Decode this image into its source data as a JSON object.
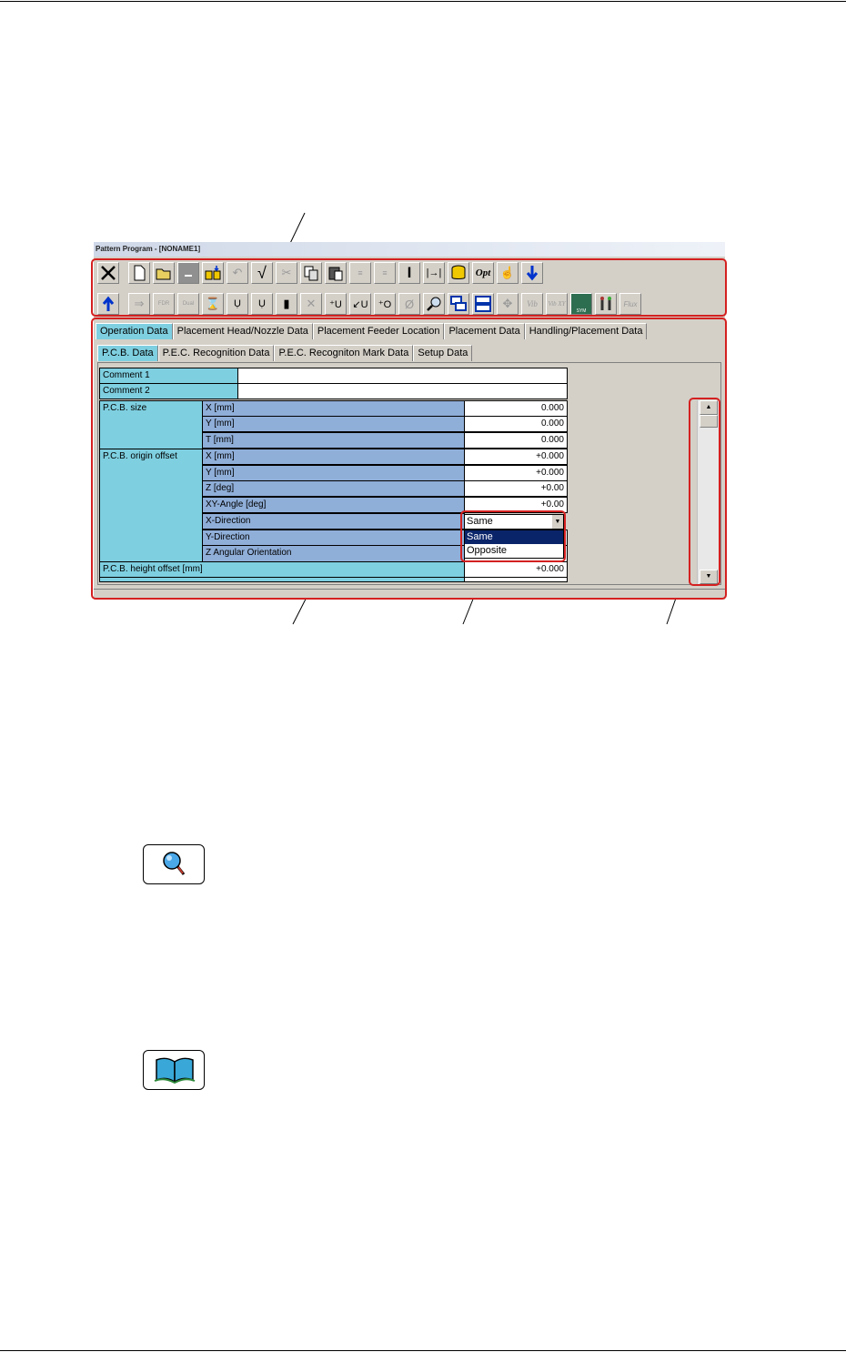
{
  "window": {
    "title": "Pattern Program - [NONAME1]"
  },
  "toolbar1": {
    "icons": [
      "close-icon",
      "new-file-icon",
      "open-folder-icon",
      "save-icon",
      "save-as-icon",
      "undo-icon",
      "check-icon",
      "cut-icon",
      "copy-icon",
      "paste-icon",
      "insert-row-icon",
      "add-row-icon",
      "cursor-icon",
      "goto-end-icon",
      "database-icon",
      "opt-icon",
      "hand-icon",
      "download-arrow-icon"
    ],
    "opt_label": "Opt"
  },
  "toolbar2": {
    "icons": [
      "up-arrow-icon",
      "transfer-icon",
      "fdr-icon",
      "dual-icon",
      "spool-icon",
      "nozzle-uv-icon",
      "nozzle-u-icon",
      "cylinder-icon",
      "cross-icon",
      "insert-u-icon",
      "place-u-icon",
      "add-o-icon",
      "no-o-icon",
      "magnifier-icon",
      "window-cascade-icon",
      "window-split-icon",
      "move-arrows-icon",
      "vib-icon",
      "vib-xy-icon",
      "sym-icon",
      "tools-icon",
      "flux-icon"
    ],
    "fdr_label": "FDR",
    "dual_label": "Dual",
    "vib_label": "Vib",
    "vibxy_label": "Vib XY",
    "sym_label": "SYM",
    "flux_label": "Flux"
  },
  "tabs_main": [
    "Operation Data",
    "Placement Head/Nozzle Data",
    "Placement Feeder Location",
    "Placement Data",
    "Handling/Placement Data"
  ],
  "tabs_sub": [
    "P.C.B. Data",
    "P.E.C. Recognition Data",
    "P.E.C. Recogniton Mark Data",
    "Setup Data"
  ],
  "grid": {
    "comment1_label": "Comment 1",
    "comment2_label": "Comment 2",
    "pcb_size_label": "P.C.B. size",
    "pcb_size_rows": [
      {
        "label": "X [mm]",
        "value": "0.000"
      },
      {
        "label": "Y [mm]",
        "value": "0.000"
      },
      {
        "label": "T [mm]",
        "value": "0.000"
      }
    ],
    "origin_offset_label": "P.C.B. origin offset",
    "origin_rows": [
      {
        "label": "X [mm]",
        "value": "+0.000"
      },
      {
        "label": "Y [mm]",
        "value": "+0.000"
      },
      {
        "label": "Z [deg]",
        "value": "+0.00"
      },
      {
        "label": "XY-Angle [deg]",
        "value": "+0.00"
      },
      {
        "label": "X-Direction",
        "value": ""
      },
      {
        "label": "Y-Direction",
        "value": ""
      },
      {
        "label": "Z Angular Orientation",
        "value": ""
      }
    ],
    "height_offset_label": "P.C.B. height offset [mm]",
    "height_offset_value": "+0.000"
  },
  "dropdown": {
    "selected": "Same",
    "options": [
      "Same",
      "Opposite"
    ],
    "highlighted": "Same"
  },
  "colors": {
    "annotation": "#d42020",
    "label_cell": "#7ecfe0",
    "sub_cell": "#8faed8",
    "highlight": "#0a246a"
  },
  "page_icons": [
    "magnifier-icon",
    "book-icon"
  ]
}
